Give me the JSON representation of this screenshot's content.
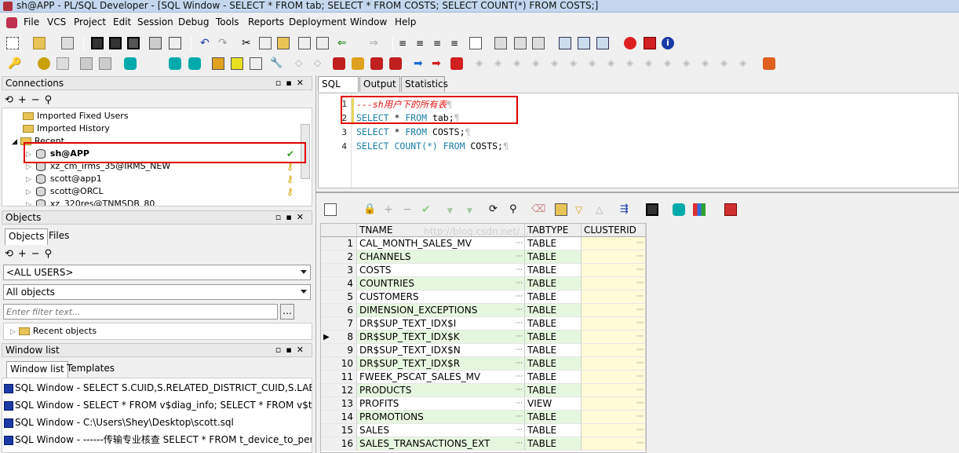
{
  "window_title": "sh@APP - PL/SQL Developer - [SQL Window - SELECT * FROM tab; SELECT * FROM COSTS; SELECT COUNT(*) FROM COSTS;]",
  "menu": [
    "File",
    "VCS",
    "Project",
    "Edit",
    "Session",
    "Debug",
    "Tools",
    "Reports",
    "Deployment",
    "Window",
    "Help"
  ],
  "connections": {
    "title": "Connections",
    "items": [
      {
        "label": "Imported Fixed Users",
        "type": "folder"
      },
      {
        "label": "Imported History",
        "type": "folder"
      },
      {
        "label": "Recent",
        "type": "folder"
      },
      {
        "label": "sh@APP",
        "type": "db",
        "bold": true
      },
      {
        "label": "xz_cm_irms_35@IRMS_NEW",
        "type": "db"
      },
      {
        "label": "scott@app1",
        "type": "db"
      },
      {
        "label": "scott@ORCL",
        "type": "db"
      },
      {
        "label": "xz_320res@TNMSDB_80",
        "type": "db"
      }
    ]
  },
  "objects": {
    "title": "Objects",
    "tabs": [
      "Objects",
      "Files"
    ],
    "user_select": "<ALL USERS>",
    "type_select": "All objects",
    "filter_placeholder": "Enter filter text...",
    "tree_item": "Recent objects"
  },
  "window_list": {
    "title": "Window list",
    "tabs": [
      "Window list",
      "Templates"
    ],
    "items": [
      "SQL Window - SELECT S.CUID,S.RELATED_DISTRICT_CUID,S.LABEL_",
      "SQL Window - SELECT * FROM v$diag_info; SELECT * FROM v$table",
      "SQL Window - C:\\Users\\Shey\\Desktop\\scott.sql",
      "SQL Window - ------传输专业核查 SELECT * FROM t_device_to_perso"
    ]
  },
  "editor": {
    "tabs": [
      "SQL",
      "Output",
      "Statistics"
    ],
    "lines": [
      {
        "num": "1",
        "parts": [
          {
            "t": "---sh用户下的所有表",
            "c": "cm"
          },
          {
            "t": "¶",
            "c": "pl"
          }
        ]
      },
      {
        "num": "2",
        "parts": [
          {
            "t": "SELECT",
            "c": "kw"
          },
          {
            "t": " * ",
            "c": ""
          },
          {
            "t": "FROM",
            "c": "kw"
          },
          {
            "t": " tab;",
            "c": ""
          },
          {
            "t": "¶",
            "c": "pl"
          }
        ]
      },
      {
        "num": "3",
        "parts": [
          {
            "t": "SELECT",
            "c": "kw"
          },
          {
            "t": " * ",
            "c": ""
          },
          {
            "t": "FROM",
            "c": "kw"
          },
          {
            "t": " COSTS;",
            "c": ""
          },
          {
            "t": "¶",
            "c": "pl"
          }
        ]
      },
      {
        "num": "4",
        "parts": [
          {
            "t": "SELECT",
            "c": "kw"
          },
          {
            "t": " COUNT(*) ",
            "c": "kw"
          },
          {
            "t": "FROM",
            "c": "kw"
          },
          {
            "t": " COSTS;",
            "c": ""
          },
          {
            "t": "¶",
            "c": "pl"
          }
        ]
      }
    ]
  },
  "grid": {
    "columns": [
      "TNAME",
      "TABTYPE",
      "CLUSTERID"
    ],
    "rows": [
      [
        "1",
        "CAL_MONTH_SALES_MV",
        "TABLE"
      ],
      [
        "2",
        "CHANNELS",
        "TABLE"
      ],
      [
        "3",
        "COSTS",
        "TABLE"
      ],
      [
        "4",
        "COUNTRIES",
        "TABLE"
      ],
      [
        "5",
        "CUSTOMERS",
        "TABLE"
      ],
      [
        "6",
        "DIMENSION_EXCEPTIONS",
        "TABLE"
      ],
      [
        "7",
        "DR$SUP_TEXT_IDX$I",
        "TABLE"
      ],
      [
        "8",
        "DR$SUP_TEXT_IDX$K",
        "TABLE"
      ],
      [
        "9",
        "DR$SUP_TEXT_IDX$N",
        "TABLE"
      ],
      [
        "10",
        "DR$SUP_TEXT_IDX$R",
        "TABLE"
      ],
      [
        "11",
        "FWEEK_PSCAT_SALES_MV",
        "TABLE"
      ],
      [
        "12",
        "PRODUCTS",
        "TABLE"
      ],
      [
        "13",
        "PROFITS",
        "VIEW"
      ],
      [
        "14",
        "PROMOTIONS",
        "TABLE"
      ],
      [
        "15",
        "SALES",
        "TABLE"
      ],
      [
        "16",
        "SALES_TRANSACTIONS_EXT",
        "TABLE"
      ]
    ],
    "current_row": "8",
    "watermark": "http://blog.csdn.net/..."
  },
  "colors": {
    "highlight": "#e00000",
    "green_row": "#e6f7df",
    "yellow_col": "#fffbd7",
    "keyword": "#1b7fa8"
  }
}
